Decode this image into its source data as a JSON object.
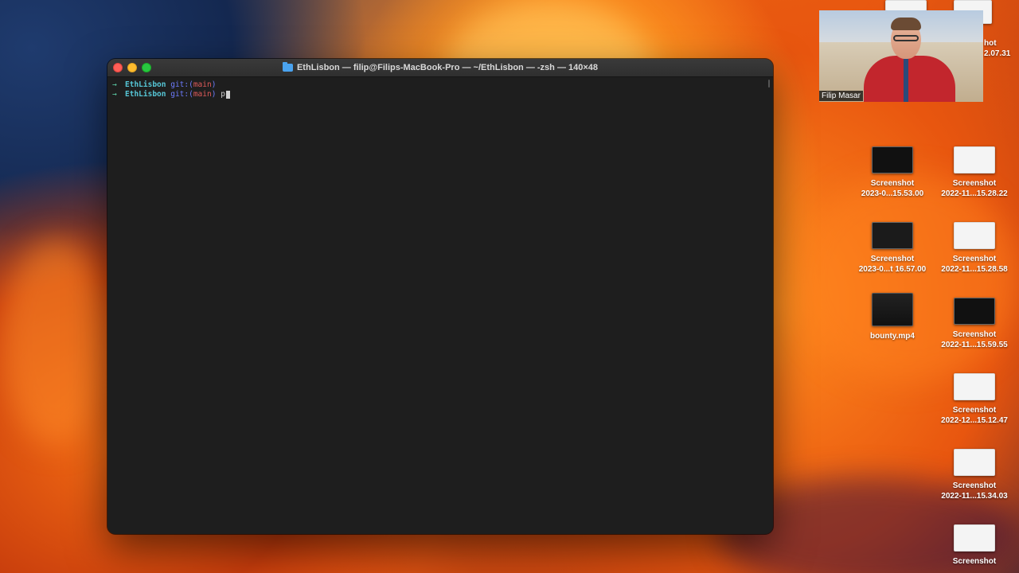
{
  "terminal": {
    "title": "EthLisbon — filip@Filips-MacBook-Pro — ~/EthLisbon — -zsh — 140×48",
    "lines": [
      {
        "arrow": "→",
        "dir": "EthLisbon",
        "git_label": "git:(",
        "branch": "main",
        "git_close": ")",
        "input": ""
      },
      {
        "arrow": "→",
        "dir": "EthLisbon",
        "git_label": "git:(",
        "branch": "main",
        "git_close": ")",
        "input": "p"
      }
    ]
  },
  "webcam": {
    "name": "Filip Masar"
  },
  "desktop": {
    "partial_top": {
      "line1": "hot",
      "line2": "2.07.31"
    },
    "icons": [
      {
        "line1": "Screenshot",
        "line2": "2023-0...15.53.00"
      },
      {
        "line1": "Screenshot",
        "line2": "2022-11...15.28.22"
      },
      {
        "line1": "Screenshot",
        "line2": "2023-0...t 16.57.00"
      },
      {
        "line1": "Screenshot",
        "line2": "2022-11...15.28.58"
      },
      {
        "line1": "bounty.mp4",
        "line2": ""
      },
      {
        "line1": "Screenshot",
        "line2": "2022-11...15.59.55"
      },
      {
        "line1": "Screenshot",
        "line2": "2022-12...15.12.47"
      },
      {
        "line1": "Screenshot",
        "line2": "2022-11...15.34.03"
      },
      {
        "line1": "Screenshot",
        "line2": ""
      }
    ]
  }
}
